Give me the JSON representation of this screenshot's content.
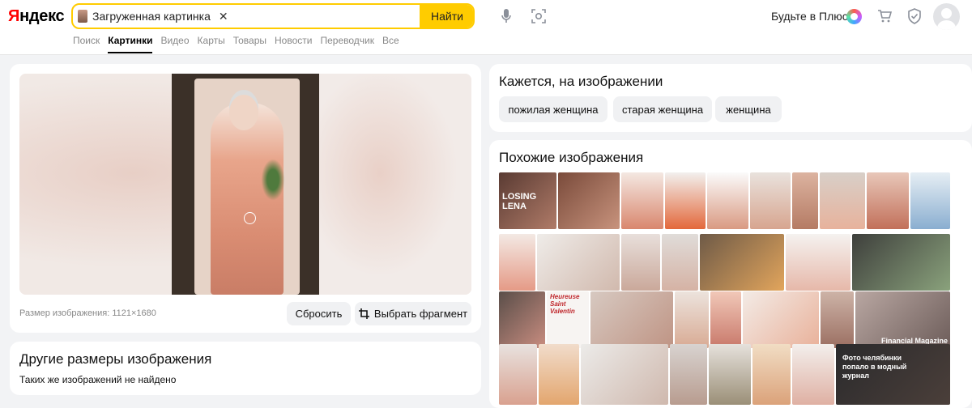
{
  "header": {
    "logo_text": "Яндекс",
    "search": {
      "chip_label": "Загруженная картинка",
      "clear_glyph": "✕",
      "button_label": "Найти"
    },
    "plus_label": "Будьте в Плюсе",
    "icons": [
      "mic-icon",
      "camera-search-icon",
      "cart-icon",
      "shield-icon",
      "avatar"
    ]
  },
  "nav": {
    "tabs": [
      {
        "label": "Поиск"
      },
      {
        "label": "Картинки",
        "active": true
      },
      {
        "label": "Видео"
      },
      {
        "label": "Карты"
      },
      {
        "label": "Товары"
      },
      {
        "label": "Новости"
      },
      {
        "label": "Переводчик"
      },
      {
        "label": "Все"
      }
    ]
  },
  "viewer": {
    "size_label": "Размер изображения: 1121×1680",
    "reset_label": "Сбросить",
    "crop_label": "Выбрать фрагмент"
  },
  "other_sizes": {
    "title": "Другие размеры изображения",
    "status": "Таких же изображений не найдено"
  },
  "seems": {
    "title": "Кажется, на изображении",
    "tags": [
      "пожилая женщина",
      "старая женщина",
      "женщина"
    ]
  },
  "similar": {
    "title": "Похожие изображения",
    "tile_texts": [
      "LOSING LENA",
      "Heureuse Saint Valentin",
      "Financial Magazine",
      "Фото челябинки попало в модный журнал"
    ]
  },
  "colors": {
    "accent": "#ffcc00",
    "link_active": "#000000",
    "muted": "#888888"
  }
}
